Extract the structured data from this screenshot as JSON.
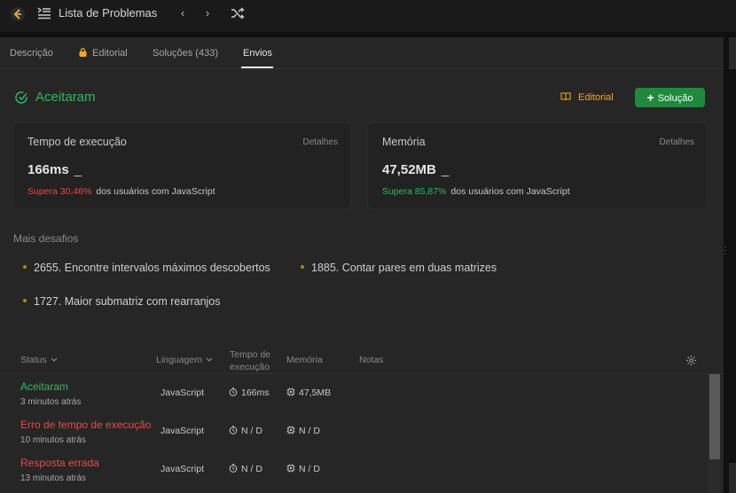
{
  "header": {
    "list_title": "Lista de Problemas",
    "prev": "‹",
    "next": "›"
  },
  "tabs": [
    "Descrição",
    "Editorial",
    "Soluções (433)",
    "Envios"
  ],
  "result": {
    "title": "Aceitaram",
    "editorial_label": "Editorial",
    "solution_label": "Solução"
  },
  "cards": [
    {
      "title": "Tempo de execução",
      "details": "Detalhes",
      "value": "166ms",
      "cursor": "_",
      "beats": "Supera 30,46%",
      "beats_rest": "dos usuários com JavaScript"
    },
    {
      "title": "Memória",
      "details": "Detalhes",
      "value": "47,52MB",
      "cursor": "_",
      "beats": "Supera 85,87%",
      "beats_rest": "dos usuários com JavaScript"
    }
  ],
  "more": {
    "title": "Mais desafios",
    "items": [
      "2655. Encontre intervalos máximos descobertos",
      "1885. Contar pares em duas matrizes",
      "1727. Maior submatriz com rearranjos"
    ]
  },
  "table": {
    "headers": {
      "status": "Status",
      "language": "Linguagem",
      "runtime_1": "Tempo de",
      "runtime_2": "execução",
      "memory": "Memória",
      "notes": "Notas"
    },
    "rows": [
      {
        "status": "Aceitaram",
        "when": "3 minutos atrás",
        "language": "JavaScript",
        "runtime": "166ms",
        "memory": "47,5MB"
      },
      {
        "status": "Erro de tempo de execução",
        "when": "10 minutos atrás",
        "language": "JavaScript",
        "runtime": "N / D",
        "memory": "N / D"
      },
      {
        "status": "Resposta errada",
        "when": "13 minutos atrás",
        "language": "JavaScript",
        "runtime": "N / D",
        "memory": "N / D"
      }
    ]
  },
  "colors": {
    "accent_green": "#2cbb5d",
    "error_red": "#ef4743",
    "editorial_orange": "#f5a623",
    "solution_button": "#1f8a3d"
  },
  "icons": [
    "logo-icon",
    "list-icon",
    "shuffle-icon",
    "lock-icon",
    "check-circle-icon",
    "book-icon",
    "plus-icon",
    "gear-icon",
    "timer-icon",
    "chip-icon"
  ]
}
